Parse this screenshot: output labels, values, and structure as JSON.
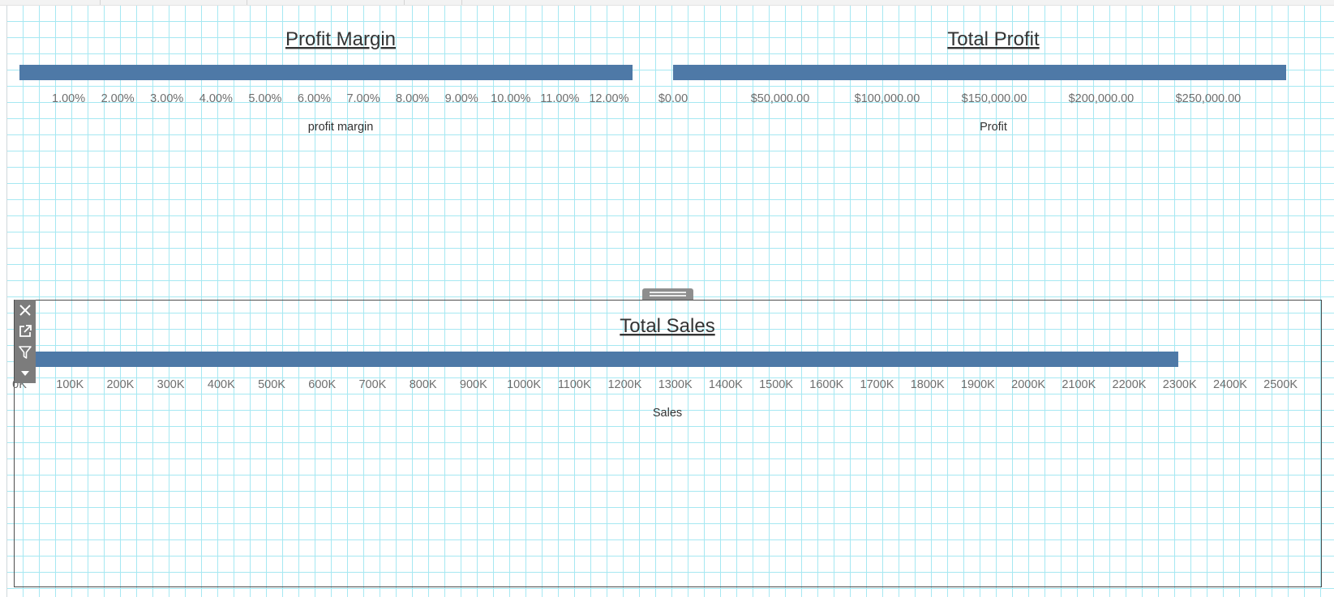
{
  "dashboard": {
    "toolbar": [
      {
        "name": "remove-from-dashboard",
        "icon": "close-icon"
      },
      {
        "name": "go-to-sheet",
        "icon": "external-link-icon"
      },
      {
        "name": "use-as-filter",
        "icon": "filter-icon"
      },
      {
        "name": "more-options",
        "icon": "caret-down-icon"
      }
    ]
  },
  "chart_data": [
    {
      "type": "bar",
      "orientation": "horizontal",
      "title": "Profit Margin",
      "xlabel": "profit margin",
      "ylabel": "",
      "values": [
        12.48
      ],
      "xlim": [
        0,
        12.48
      ],
      "ticks": [
        1,
        2,
        3,
        4,
        5,
        6,
        7,
        8,
        9,
        10,
        11,
        12
      ],
      "tick_labels": [
        "1.00%",
        "2.00%",
        "3.00%",
        "4.00%",
        "5.00%",
        "6.00%",
        "7.00%",
        "8.00%",
        "9.00%",
        "10.00%",
        "11.00%",
        "12.00%"
      ],
      "grid": false,
      "color": "#4e79a7"
    },
    {
      "type": "bar",
      "orientation": "horizontal",
      "title": "Total Profit",
      "xlabel": "Profit",
      "ylabel": "",
      "values": [
        286397
      ],
      "xlim": [
        0,
        286397
      ],
      "ticks": [
        0,
        50000,
        100000,
        150000,
        200000,
        250000
      ],
      "tick_labels": [
        "$0.00",
        "$50,000.00",
        "$100,000.00",
        "$150,000.00",
        "$200,000.00",
        "$250,000.00"
      ],
      "grid": false,
      "color": "#4e79a7"
    },
    {
      "type": "bar",
      "orientation": "horizontal",
      "title": "Total Sales",
      "xlabel": "Sales",
      "ylabel": "",
      "values": [
        2297201
      ],
      "xlim": [
        0,
        2540000
      ],
      "ticks": [
        0,
        100000,
        200000,
        300000,
        400000,
        500000,
        600000,
        700000,
        800000,
        900000,
        1000000,
        1100000,
        1200000,
        1300000,
        1400000,
        1500000,
        1600000,
        1700000,
        1800000,
        1900000,
        2000000,
        2100000,
        2200000,
        2300000,
        2400000,
        2500000
      ],
      "tick_labels": [
        "0K",
        "100K",
        "200K",
        "300K",
        "400K",
        "500K",
        "600K",
        "700K",
        "800K",
        "900K",
        "1000K",
        "1100K",
        "1200K",
        "1300K",
        "1400K",
        "1500K",
        "1600K",
        "1700K",
        "1800K",
        "1900K",
        "2000K",
        "2100K",
        "2200K",
        "2300K",
        "2400K",
        "2500K"
      ],
      "grid": false,
      "color": "#4e79a7"
    }
  ]
}
